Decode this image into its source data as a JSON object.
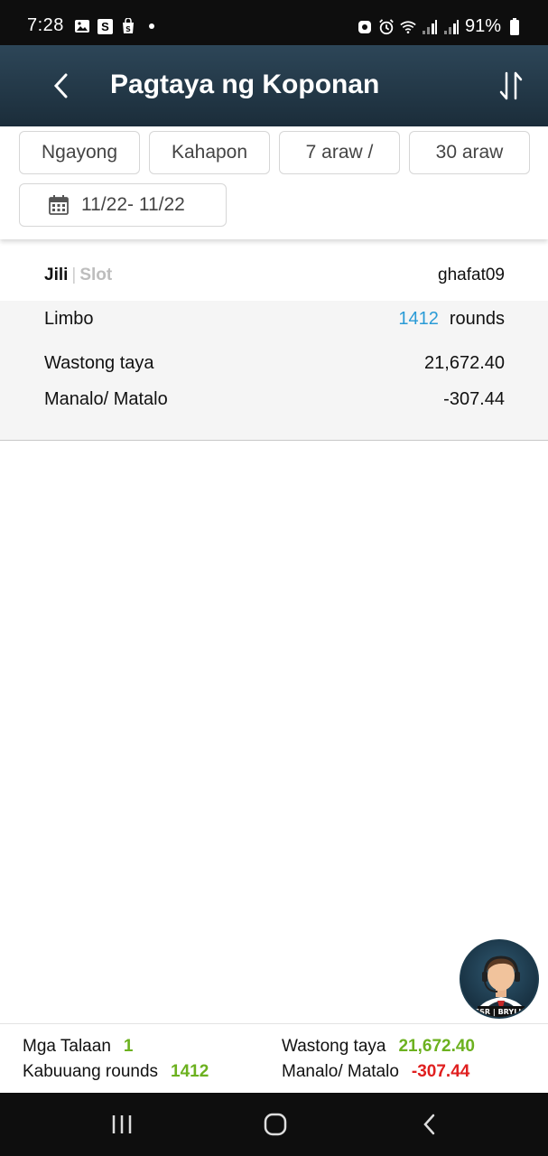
{
  "status_bar": {
    "time": "7:28",
    "battery": "91%",
    "icons_left": [
      "image-icon",
      "s-app-icon",
      "shop-icon",
      "notification-dot"
    ],
    "icons_right": [
      "vpn-icon",
      "alarm-icon",
      "wifi-icon",
      "signal-icon",
      "signal-icon",
      "battery-icon"
    ]
  },
  "header": {
    "title": "Pagtaya ng Koponan",
    "colors": {
      "top": "#2d4658",
      "bottom": "#1b2d3a"
    }
  },
  "filters": {
    "chips": [
      "Ngayong",
      "Kahapon",
      "7 araw /",
      "30 araw"
    ],
    "date_range": "11/22- 11/22"
  },
  "record": {
    "provider": "Jili",
    "separator": "|",
    "category": "Slot",
    "username": "ghafat09",
    "game": "Limbo",
    "rounds": "1412",
    "rounds_label": "rounds",
    "valid_bet_label": "Wastong taya",
    "valid_bet_value": "21,672.40",
    "win_loss_label": "Manalo/ Matalo",
    "win_loss_value": "-307.44"
  },
  "summary": {
    "records_label": "Mga Talaan",
    "records_value": "1",
    "total_rounds_label": "Kabuuang rounds",
    "total_rounds_value": "1412",
    "valid_bet_label": "Wastong taya",
    "valid_bet_value": "21,672.40",
    "win_loss_label": "Manalo/ Matalo",
    "win_loss_value": "-307.44",
    "colors": {
      "positive": "#6cb11f",
      "negative": "#e02020"
    }
  },
  "support_avatar": {
    "badge_text": "CSR | BRYLLE"
  },
  "nav_bar": {
    "buttons": [
      "recent-apps-icon",
      "home-icon",
      "back-icon"
    ]
  }
}
